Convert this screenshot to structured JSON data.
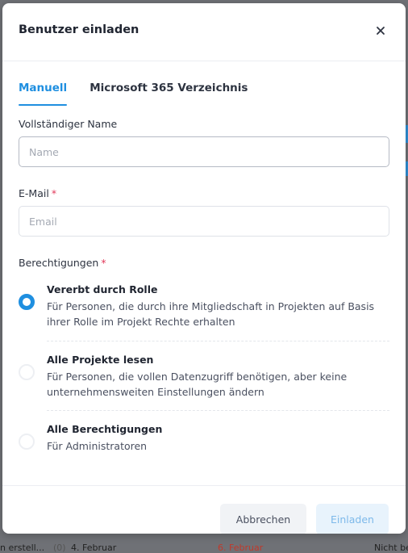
{
  "background": {
    "fragment_1": "n erstell...",
    "fragment_2": "(0)",
    "fragment_3": "4. Februar",
    "fragment_4": "6. Februar",
    "fragment_5": "Nicht be"
  },
  "modal": {
    "title": "Benutzer einladen",
    "close_icon": "close-icon"
  },
  "tabs": [
    {
      "label": "Manuell",
      "active": true
    },
    {
      "label": "Microsoft 365 Verzeichnis",
      "active": false
    }
  ],
  "form": {
    "name_label": "Vollständiger Name",
    "name_placeholder": "Name",
    "email_label": "E-Mail",
    "email_placeholder": "Email",
    "required_mark": "*",
    "permissions_label": "Berechtigungen"
  },
  "permissions": [
    {
      "title": "Vererbt durch Rolle",
      "description": "Für Personen, die durch ihre Mitgliedschaft in Projekten auf Basis ihrer Rolle im Projekt Rechte erhalten",
      "selected": true
    },
    {
      "title": "Alle Projekte lesen",
      "description": "Für Personen, die vollen Datenzugriff benötigen, aber keine unternehmensweiten Einstellungen ändern",
      "selected": false
    },
    {
      "title": "Alle Berechtigungen",
      "description": "Für Administratoren",
      "selected": false
    }
  ],
  "footer": {
    "cancel_label": "Abbrechen",
    "invite_label": "Einladen"
  },
  "colors": {
    "accent": "#1f8fe0",
    "required": "#e23a5a",
    "invite_button_bg": "#e8f3fc"
  }
}
